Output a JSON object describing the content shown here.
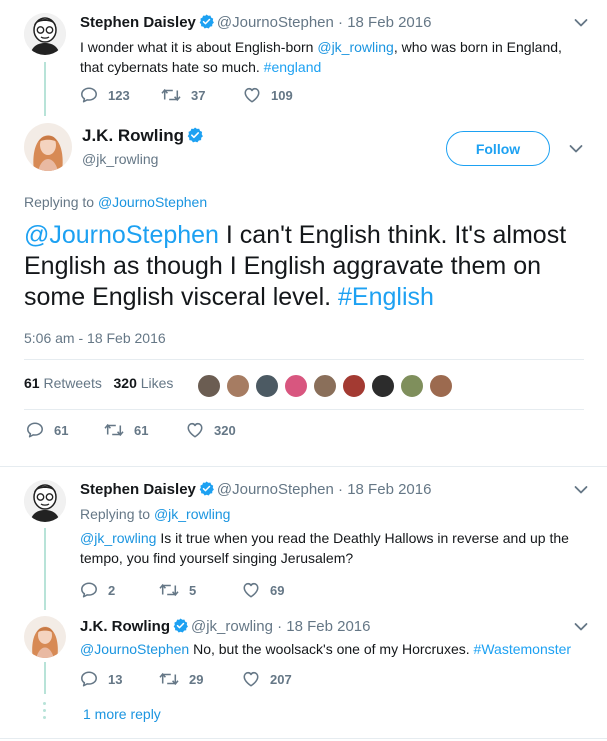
{
  "tweet1": {
    "name": "Stephen Daisley",
    "handle": "@JournoStephen",
    "date": "· 18 Feb 2016",
    "text_a": "I wonder what it is about English-born ",
    "mention": "@jk_rowling",
    "text_b": ", who was born in England, that cybernats hate so much. ",
    "hashtag": "#england",
    "replies": "123",
    "retweets": "37",
    "likes": "109"
  },
  "main": {
    "name": "J.K. Rowling",
    "handle": "@jk_rowling",
    "follow_label": "Follow",
    "replying_label": "Replying to ",
    "replying_to": "@JournoStephen",
    "mention": "@JournoStephen",
    "text": " I can't English think. It's almost English as though I English aggravate them on some English visceral level. ",
    "hashtag": "#English",
    "timestamp": "5:06 am - 18 Feb 2016",
    "retweet_count": "61",
    "retweet_label": "Retweets",
    "like_count": "320",
    "like_label": "Likes",
    "replies": "61",
    "retweets": "61",
    "likes": "320"
  },
  "reply1": {
    "name": "Stephen Daisley",
    "handle": "@JournoStephen",
    "date": "· 18 Feb 2016",
    "replying_label": "Replying to ",
    "replying_to": "@jk_rowling",
    "mention": "@jk_rowling",
    "text": " Is it true when you read the Deathly Hallows in reverse and up the tempo, you find yourself singing Jerusalem?",
    "replies": "2",
    "retweets": "5",
    "likes": "69"
  },
  "reply2": {
    "name": "J.K. Rowling",
    "handle": "@jk_rowling",
    "date": "· 18 Feb 2016",
    "mention": "@JournoStephen",
    "text": " No, but the woolsack's one of my Horcruxes. ",
    "hashtag": "#Wastemonster",
    "replies": "13",
    "retweets": "29",
    "likes": "207"
  },
  "more_reply": "1 more reply",
  "colors": {
    "accent": "#1da1f2",
    "link": "#1b95e0",
    "muted": "#657786",
    "thread": "#b8e3d8",
    "verified": "#1da1f2"
  },
  "icons": [
    "reply-icon",
    "retweet-icon",
    "like-icon",
    "chevron-down-icon",
    "verified-icon"
  ]
}
